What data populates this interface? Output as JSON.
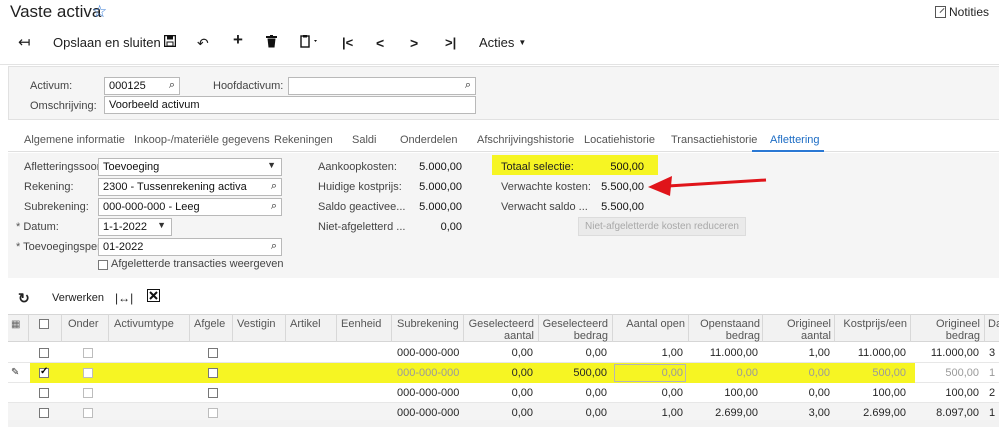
{
  "title": "Vaste activa",
  "notes_label": "Notities",
  "toolbar": {
    "back_icon": "arrow-left-icon",
    "save_close_label": "Opslaan en sluiten",
    "actions_label": "Acties"
  },
  "header": {
    "activum_label": "Activum:",
    "activum_value": "000125",
    "hoofdactivum_label": "Hoofdactivum:",
    "hoofdactivum_value": "",
    "omschrijving_label": "Omschrijving:",
    "omschrijving_value": "Voorbeeld activum"
  },
  "tabs": [
    {
      "label": "Algemene informatie"
    },
    {
      "label": "Inkoop-/materiële gegevens"
    },
    {
      "label": "Rekeningen"
    },
    {
      "label": "Saldi"
    },
    {
      "label": "Onderdelen"
    },
    {
      "label": "Afschrijvingshistorie"
    },
    {
      "label": "Locatiehistorie"
    },
    {
      "label": "Transactiehistorie"
    },
    {
      "label": "Afletteringg"
    }
  ],
  "afletter": {
    "soort_label": "Afletteringssoort:",
    "soort_value": "Toevoeging",
    "rekening_label": "Rekening:",
    "rekening_value": "2300 - Tussenrekening activa",
    "subrekening_label": "Subrekening:",
    "subrekening_value": "000-000-000 - Leeg",
    "datum_label": "Datum:",
    "datum_value": "1-1-2022",
    "periode_label": "Toevoegingsperi...",
    "periode_value": "01-2022",
    "show_label": "Afgeletterde transacties weergeven",
    "aankoop_label": "Aankoopkosten:",
    "aankoop_value": "5.000,00",
    "kostprijs_label": "Huidige kostprijs:",
    "kostprijs_value": "5.000,00",
    "saldo_label": "Saldo geactivee...",
    "saldo_value": "5.000,00",
    "niet_label": "Niet-afgeletterd ...",
    "niet_value": "0,00",
    "totaal_label": "Totaal selectie:",
    "totaal_value": "500,00",
    "verwacht_label": "Verwachte kosten:",
    "verwacht_value": "5.500,00",
    "verwacht_saldo_label": "Verwacht saldo ...",
    "verwacht_saldo_value": "5.500,00",
    "reduce_button": "Niet-afgeletterde kosten reduceren"
  },
  "grid_toolbar": {
    "process_label": "Verwerken"
  },
  "columns": [
    "Onder",
    "Activumtype",
    "Afgele",
    "Vestigin",
    "Artikel",
    "Eenheid",
    "Subrekening",
    "Geselecteerd\naantal",
    "Geselecteerd\nbedrag",
    "Aantal open",
    "Openstaand\nbedrag",
    "Origineel\naantal",
    "Kostprijs/een",
    "Origineel\nbedrag",
    "Da"
  ],
  "rows": [
    {
      "sub": "000-000-000",
      "sel_aantal": "0,00",
      "sel_bedrag": "0,00",
      "open_aantal": "1,00",
      "open_bedrag": "11.000,00",
      "orig_aantal": "1,00",
      "kostprijs": "11.000,00",
      "orig_bedrag": "11.000,00",
      "da": "3"
    },
    {
      "sub": "000-000-000",
      "sel_aantal": "0,00",
      "sel_bedrag": "500,00",
      "open_aantal": "0,00",
      "open_bedrag": "0,00",
      "orig_aantal": "0,00",
      "kostprijs": "500,00",
      "orig_bedrag": "500,00",
      "da": "1"
    },
    {
      "sub": "000-000-000",
      "sel_aantal": "0,00",
      "sel_bedrag": "0,00",
      "open_aantal": "0,00",
      "open_bedrag": "100,00",
      "orig_aantal": "0,00",
      "kostprijs": "100,00",
      "orig_bedrag": "100,00",
      "da": "2"
    },
    {
      "sub": "000-000-000",
      "sel_aantal": "0,00",
      "sel_bedrag": "0,00",
      "open_aantal": "1,00",
      "open_bedrag": "2.699,00",
      "orig_aantal": "3,00",
      "kostprijs": "2.699,00",
      "orig_bedrag": "8.097,00",
      "da": "1"
    }
  ],
  "colors": {
    "highlight": "#f6f523",
    "accent": "#2a78d4",
    "arrow": "#e0141a"
  }
}
